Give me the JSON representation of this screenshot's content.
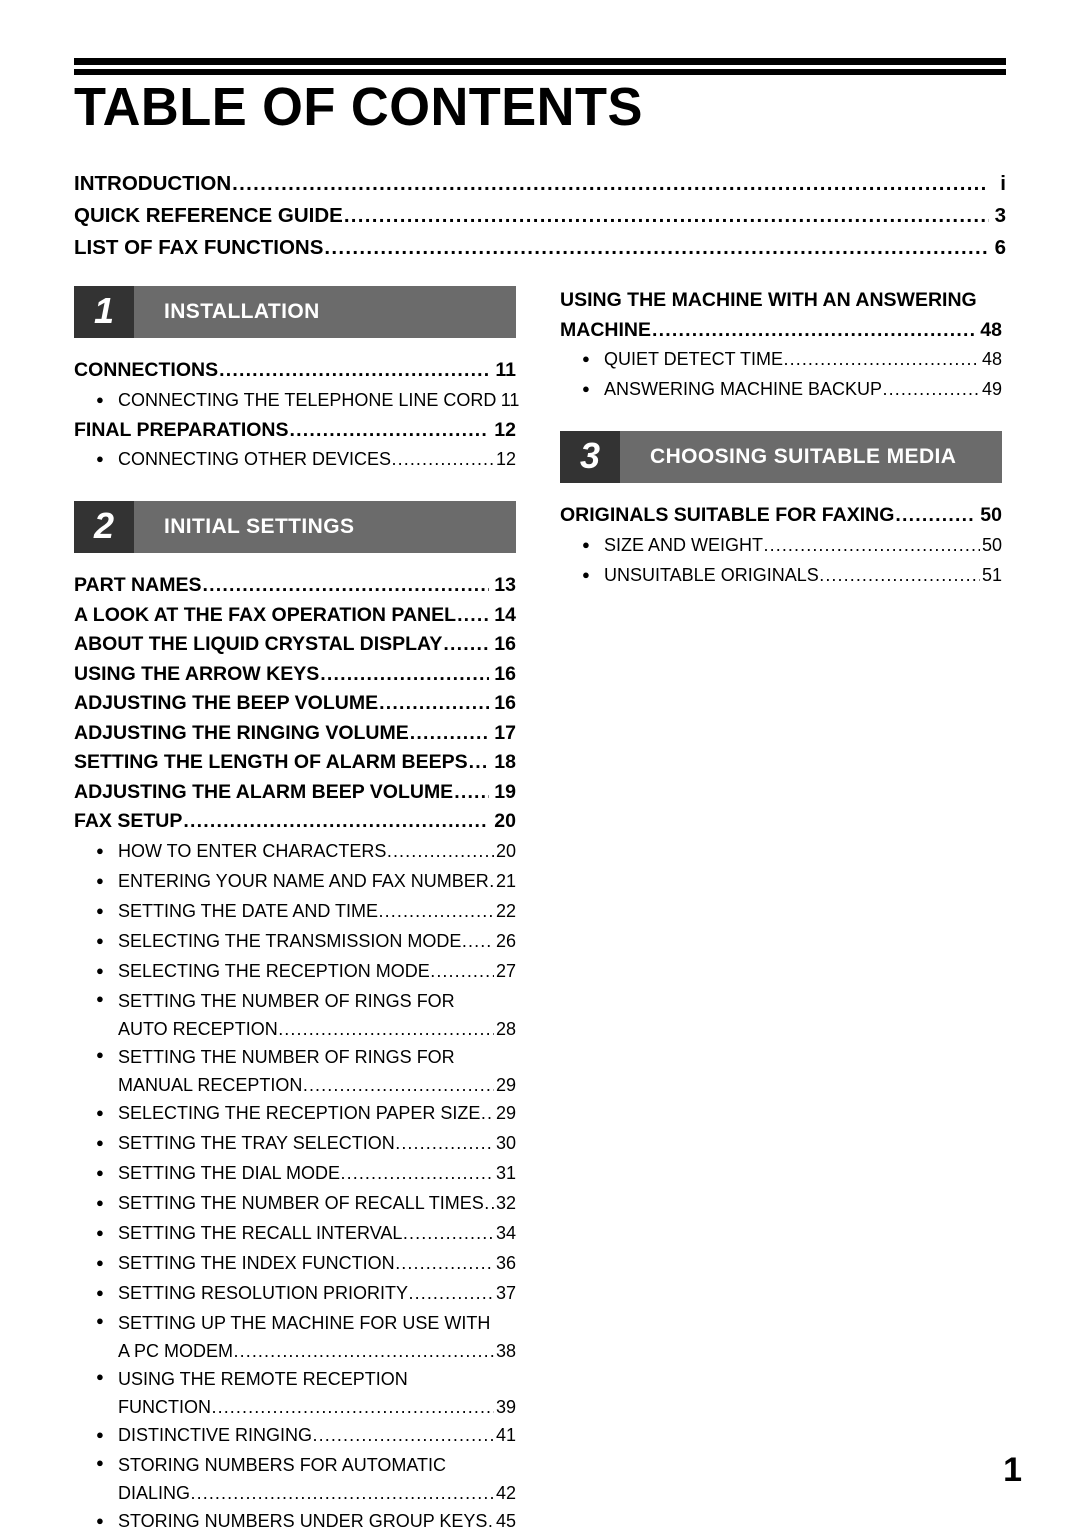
{
  "document": {
    "title": "TABLE OF CONTENTS",
    "folio": "1",
    "leader": "................................................................................................................................................................",
    "bullet": "●"
  },
  "front_matter": [
    {
      "label": "INTRODUCTION",
      "page": "i"
    },
    {
      "label": "QUICK REFERENCE GUIDE",
      "page": "3"
    },
    {
      "label": "LIST OF FAX FUNCTIONS",
      "page": "6"
    }
  ],
  "chapters": {
    "installation": {
      "number": "1",
      "title": "INSTALLATION"
    },
    "initial": {
      "number": "2",
      "title": "INITIAL SETTINGS"
    },
    "media": {
      "number": "3",
      "title": "CHOOSING SUITABLE MEDIA"
    }
  },
  "left_column": {
    "installation_entries": [
      {
        "label": "CONNECTIONS",
        "page": "11"
      },
      {
        "label": "CONNECTING THE TELEPHONE LINE CORD",
        "page": "11"
      },
      {
        "label": "FINAL PREPARATIONS",
        "page": "12"
      },
      {
        "label": "CONNECTING OTHER DEVICES",
        "page": "12"
      }
    ],
    "initial_entries": [
      {
        "label": "PART NAMES",
        "page": "13"
      },
      {
        "label": "A LOOK AT THE FAX OPERATION PANEL",
        "page": "14"
      },
      {
        "label": "ABOUT THE LIQUID CRYSTAL DISPLAY",
        "page": "16"
      },
      {
        "label": "USING THE ARROW KEYS",
        "page": "16"
      },
      {
        "label": "ADJUSTING THE BEEP VOLUME",
        "page": "16"
      },
      {
        "label": "ADJUSTING THE RINGING VOLUME",
        "page": "17"
      },
      {
        "label": "SETTING THE LENGTH OF ALARM BEEPS",
        "page": "18"
      },
      {
        "label": "ADJUSTING THE ALARM BEEP VOLUME",
        "page": "19"
      },
      {
        "label": "FAX SETUP",
        "page": "20"
      }
    ],
    "fax_setup_subentries": [
      {
        "label": "HOW TO ENTER CHARACTERS",
        "page": "20"
      },
      {
        "label": "ENTERING YOUR NAME AND FAX NUMBER",
        "page": "21"
      },
      {
        "label": "SETTING THE DATE AND TIME",
        "page": "22"
      },
      {
        "label": "SELECTING THE TRANSMISSION MODE",
        "page": "26"
      },
      {
        "label": "SELECTING THE RECEPTION MODE",
        "page": "27"
      },
      {
        "label": "SETTING THE NUMBER OF RINGS FOR",
        "label2": "AUTO RECEPTION",
        "page": "28"
      },
      {
        "label": "SETTING THE NUMBER OF RINGS FOR",
        "label2": "MANUAL RECEPTION",
        "page": "29"
      },
      {
        "label": "SELECTING THE RECEPTION PAPER SIZE",
        "page": "29"
      },
      {
        "label": "SETTING THE TRAY SELECTION",
        "page": "30"
      },
      {
        "label": "SETTING THE DIAL MODE",
        "page": "31"
      },
      {
        "label": "SETTING THE NUMBER OF RECALL TIMES",
        "page": "32"
      },
      {
        "label": "SETTING THE RECALL INTERVAL",
        "page": "34"
      },
      {
        "label": "SETTING THE INDEX FUNCTION",
        "page": "36"
      },
      {
        "label": "SETTING RESOLUTION PRIORITY",
        "page": "37"
      },
      {
        "label": "SETTING UP THE MACHINE FOR USE WITH",
        "label2": "A PC MODEM",
        "page": "38"
      },
      {
        "label": "USING THE REMOTE RECEPTION",
        "label2": "FUNCTION",
        "page": "39"
      },
      {
        "label": "DISTINCTIVE RINGING",
        "page": "41"
      },
      {
        "label": "STORING NUMBERS FOR AUTOMATIC",
        "label2": "DIALING",
        "page": "42"
      },
      {
        "label": "STORING NUMBERS UNDER GROUP KEYS",
        "page": "45"
      }
    ]
  },
  "right_column": {
    "answering_machine": {
      "label_line1": "USING THE MACHINE WITH AN ANSWERING",
      "label_line2": "MACHINE",
      "page": "48"
    },
    "answering_machine_subentries": [
      {
        "label": "QUIET DETECT TIME",
        "page": "48"
      },
      {
        "label": "ANSWERING MACHINE BACKUP",
        "page": "49"
      }
    ],
    "media_entry": {
      "label": "ORIGINALS SUITABLE FOR FAXING",
      "page": "50"
    },
    "media_subentries": [
      {
        "label": "SIZE AND WEIGHT",
        "page": "50"
      },
      {
        "label": "UNSUITABLE ORIGINALS",
        "page": "51"
      }
    ]
  },
  "colors": {
    "chapter_number_bg": "#333333",
    "chapter_title_bg": "#6b6b6b",
    "text": "#000000",
    "page_bg": "#ffffff"
  }
}
